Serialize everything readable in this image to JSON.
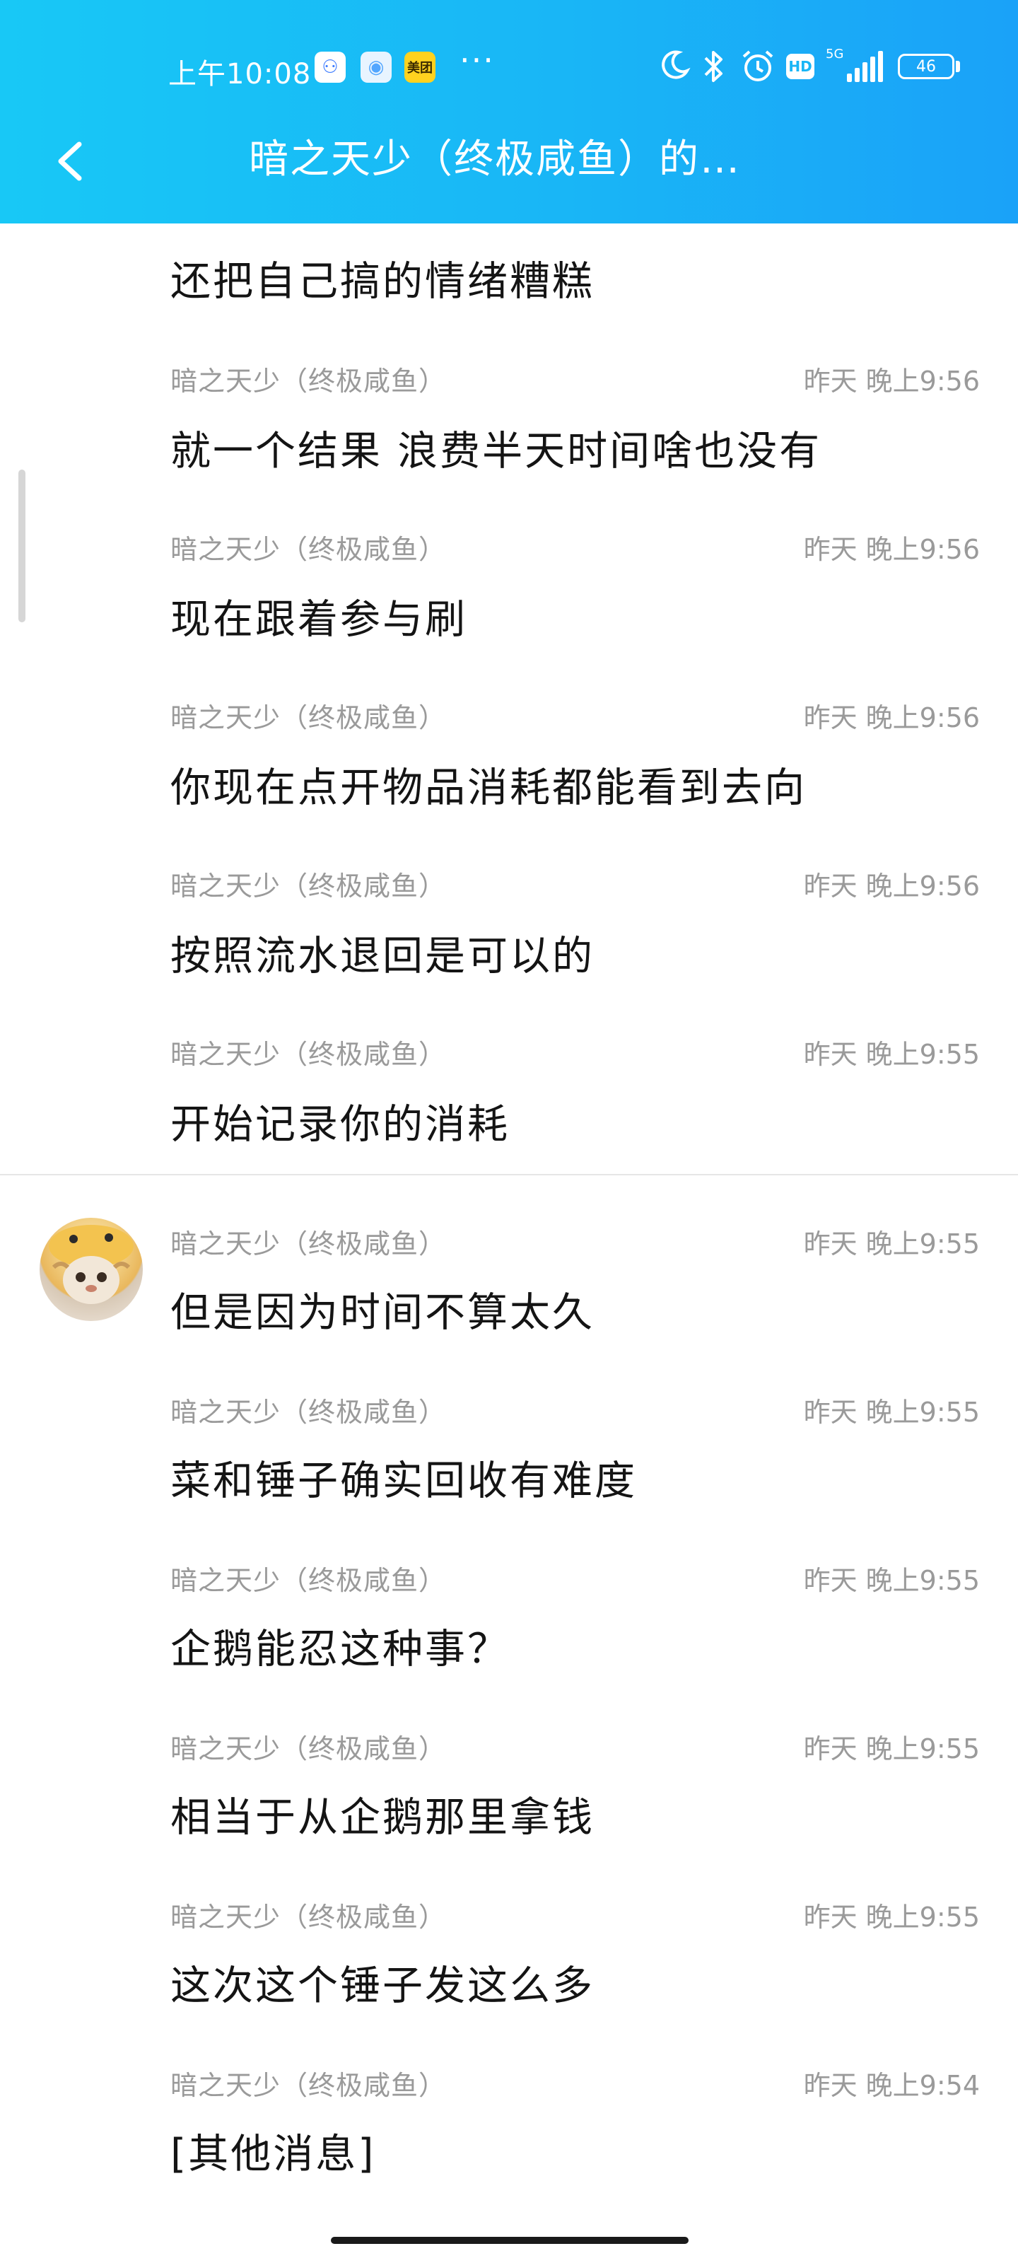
{
  "status_bar": {
    "time": "上午10:08",
    "app_badges": [
      "⚇",
      "◉",
      "美团"
    ],
    "more": "···",
    "icons": [
      "moon-icon",
      "bluetooth-icon",
      "alarm-icon",
      "hd-icon",
      "5g-signal-icon",
      "battery-icon"
    ],
    "hd_label": "HD",
    "network_label": "5G",
    "battery_level": "46"
  },
  "header": {
    "title": "暗之天少（终极咸鱼）的…",
    "background_colors": [
      "#18c8f6",
      "#1aa2f8"
    ]
  },
  "messages": [
    {
      "sender": "",
      "time": "",
      "text": "还把自己搞的情绪糟糕"
    },
    {
      "sender": "暗之天少（终极咸鱼）",
      "time": "昨天 晚上9:56",
      "text": "就一个结果 浪费半天时间啥也没有"
    },
    {
      "sender": "暗之天少（终极咸鱼）",
      "time": "昨天 晚上9:56",
      "text": "现在跟着参与刷"
    },
    {
      "sender": "暗之天少（终极咸鱼）",
      "time": "昨天 晚上9:56",
      "text": "你现在点开物品消耗都能看到去向"
    },
    {
      "sender": "暗之天少（终极咸鱼）",
      "time": "昨天 晚上9:56",
      "text": "按照流水退回是可以的"
    },
    {
      "sender": "暗之天少（终极咸鱼）",
      "time": "昨天 晚上9:55",
      "text": "开始记录你的消耗"
    },
    {
      "sender": "暗之天少（终极咸鱼）",
      "time": "昨天 晚上9:55",
      "text": "但是因为时间不算太久"
    },
    {
      "sender": "暗之天少（终极咸鱼）",
      "time": "昨天 晚上9:55",
      "text": "菜和锤子确实回收有难度"
    },
    {
      "sender": "暗之天少（终极咸鱼）",
      "time": "昨天 晚上9:55",
      "text": "企鹅能忍这种事？"
    },
    {
      "sender": "暗之天少（终极咸鱼）",
      "time": "昨天 晚上9:55",
      "text": "相当于从企鹅那里拿钱"
    },
    {
      "sender": "暗之天少（终极咸鱼）",
      "time": "昨天 晚上9:55",
      "text": "这次这个锤子发这么多"
    },
    {
      "sender": "暗之天少（终极咸鱼）",
      "time": "昨天 晚上9:54",
      "text": "[其他消息]"
    }
  ]
}
